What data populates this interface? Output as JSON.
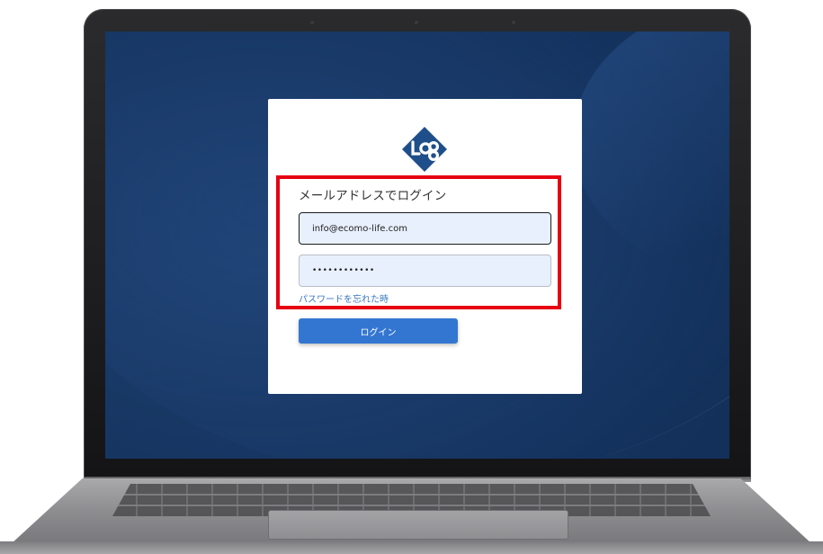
{
  "login": {
    "heading": "メールアドレスでログイン",
    "email_value": "info@ecomo-life.com",
    "password_value": "••••••••••••",
    "forgot_password": "パスワードを忘れた時",
    "submit_label": "ログイン"
  },
  "colors": {
    "highlight_box": "#e60012",
    "button_bg": "#3376d2",
    "link": "#3a78c2",
    "logo": "#1f4f8a",
    "screen_bg": "#14325d",
    "input_bg": "#e8f0fe"
  },
  "icons": {
    "logo": "diamond-logo-icon"
  }
}
